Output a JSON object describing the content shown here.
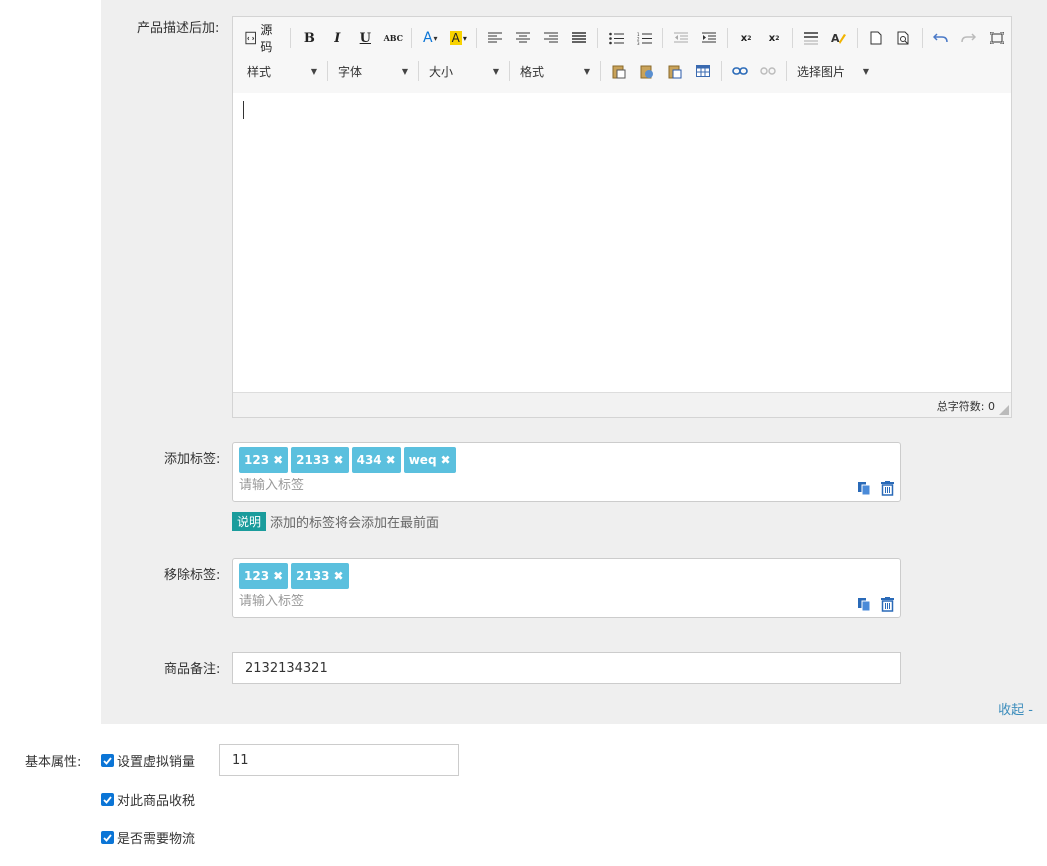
{
  "product_desc_after": {
    "label": "产品描述后加:",
    "toolbar": {
      "source_label": "源码",
      "combos": [
        "样式",
        "字体",
        "大小",
        "格式"
      ],
      "image_select_label": "选择图片"
    },
    "word_count_label": "总字符数:",
    "word_count": "0"
  },
  "add_tags": {
    "label": "添加标签:",
    "tags": [
      "123",
      "2133",
      "434",
      "weq"
    ],
    "placeholder": "请输入标签",
    "note_badge": "说明",
    "note_text": "添加的标签将会添加在最前面"
  },
  "remove_tags": {
    "label": "移除标签:",
    "tags": [
      "123",
      "2133"
    ],
    "placeholder": "请输入标签"
  },
  "remark": {
    "label": "商品备注:",
    "value": "2132134321"
  },
  "collapse_label": "收起 -",
  "basic_attrs": {
    "label": "基本属性:",
    "virtual_sales": {
      "label": "设置虚拟销量",
      "checked": true,
      "value": "11"
    },
    "tax": {
      "label": "对此商品收税",
      "checked": true
    },
    "logistics": {
      "label": "是否需要物流",
      "checked": true
    }
  },
  "colors": {
    "tag": "#5bc0de",
    "note_badge": "#1a9c9c",
    "link": "#3c8dbc",
    "checkbox": "#0b75d6"
  }
}
